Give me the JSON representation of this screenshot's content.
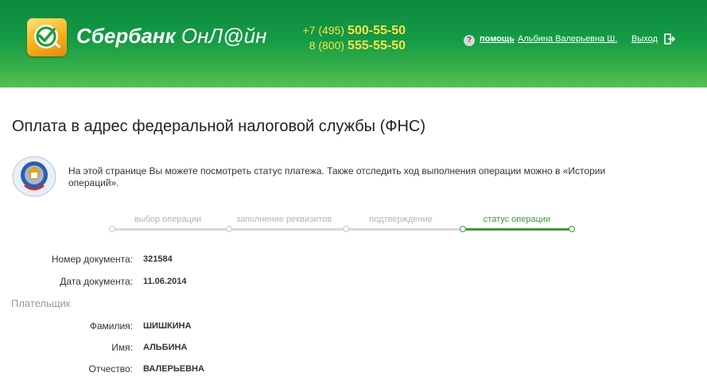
{
  "header": {
    "brand_main": "Сбербанк",
    "brand_sub": "ОнЛ@йн",
    "phones": [
      {
        "code": "+7 (495)",
        "number": "500-55-50"
      },
      {
        "code": "8 (800)",
        "number": "555-55-50"
      }
    ],
    "help_label": "помощь",
    "user_name": "Альбина Валерьевна Ш.",
    "logout_label": "Выход"
  },
  "page": {
    "title": "Оплата в адрес федеральной налоговой службы (ФНС)",
    "info_text": "На этой странице Вы можете посмотреть статус платежа. Также отследить ход выполнения операции можно в «Истории операций»."
  },
  "steps": [
    {
      "label": "выбор операции",
      "active": false
    },
    {
      "label": "заполнение реквизитов",
      "active": false
    },
    {
      "label": "подтверждение",
      "active": false
    },
    {
      "label": "статус операции",
      "active": true
    }
  ],
  "document": {
    "number_label": "Номер документа:",
    "number_value": "321584",
    "date_label": "Дата документа:",
    "date_value": "11.06.2014"
  },
  "payer": {
    "section_title": "Плательщик",
    "surname_label": "Фамилия:",
    "surname_value": "ШИШКИНА",
    "name_label": "Имя:",
    "name_value": "АЛЬБИНА",
    "patronymic_label": "Отчество:",
    "patronymic_value": "ВАЛЕРЬЕВНА"
  },
  "colors": {
    "header_green": "#149a45",
    "phone_yellow": "#ffe14a",
    "step_active": "#3f9a3a",
    "step_inactive": "#d9d9d9"
  }
}
